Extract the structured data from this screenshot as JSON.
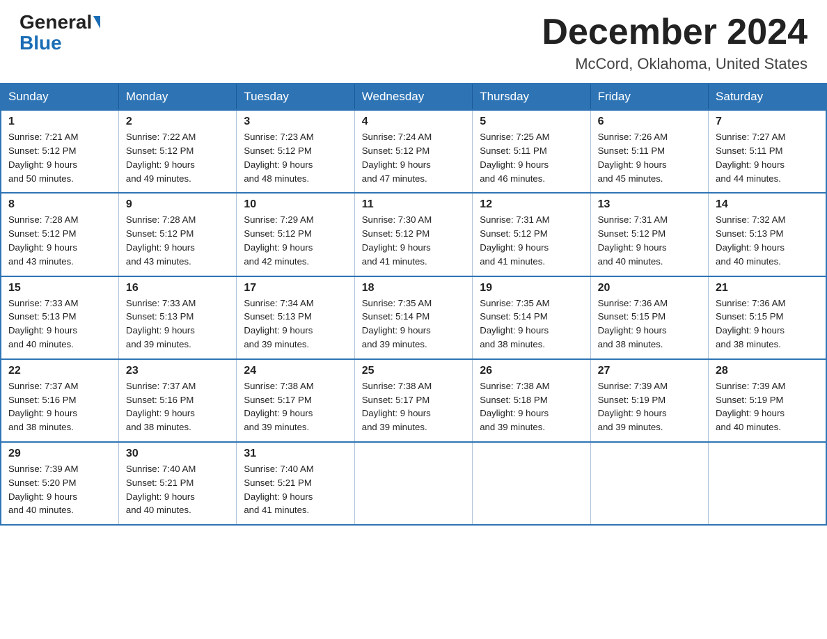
{
  "header": {
    "logo": {
      "part1": "General",
      "part2": "Blue"
    },
    "title": "December 2024",
    "subtitle": "McCord, Oklahoma, United States"
  },
  "calendar": {
    "days_of_week": [
      "Sunday",
      "Monday",
      "Tuesday",
      "Wednesday",
      "Thursday",
      "Friday",
      "Saturday"
    ],
    "weeks": [
      [
        {
          "day": "1",
          "sunrise": "7:21 AM",
          "sunset": "5:12 PM",
          "daylight": "9 hours and 50 minutes."
        },
        {
          "day": "2",
          "sunrise": "7:22 AM",
          "sunset": "5:12 PM",
          "daylight": "9 hours and 49 minutes."
        },
        {
          "day": "3",
          "sunrise": "7:23 AM",
          "sunset": "5:12 PM",
          "daylight": "9 hours and 48 minutes."
        },
        {
          "day": "4",
          "sunrise": "7:24 AM",
          "sunset": "5:12 PM",
          "daylight": "9 hours and 47 minutes."
        },
        {
          "day": "5",
          "sunrise": "7:25 AM",
          "sunset": "5:11 PM",
          "daylight": "9 hours and 46 minutes."
        },
        {
          "day": "6",
          "sunrise": "7:26 AM",
          "sunset": "5:11 PM",
          "daylight": "9 hours and 45 minutes."
        },
        {
          "day": "7",
          "sunrise": "7:27 AM",
          "sunset": "5:11 PM",
          "daylight": "9 hours and 44 minutes."
        }
      ],
      [
        {
          "day": "8",
          "sunrise": "7:28 AM",
          "sunset": "5:12 PM",
          "daylight": "9 hours and 43 minutes."
        },
        {
          "day": "9",
          "sunrise": "7:28 AM",
          "sunset": "5:12 PM",
          "daylight": "9 hours and 43 minutes."
        },
        {
          "day": "10",
          "sunrise": "7:29 AM",
          "sunset": "5:12 PM",
          "daylight": "9 hours and 42 minutes."
        },
        {
          "day": "11",
          "sunrise": "7:30 AM",
          "sunset": "5:12 PM",
          "daylight": "9 hours and 41 minutes."
        },
        {
          "day": "12",
          "sunrise": "7:31 AM",
          "sunset": "5:12 PM",
          "daylight": "9 hours and 41 minutes."
        },
        {
          "day": "13",
          "sunrise": "7:31 AM",
          "sunset": "5:12 PM",
          "daylight": "9 hours and 40 minutes."
        },
        {
          "day": "14",
          "sunrise": "7:32 AM",
          "sunset": "5:13 PM",
          "daylight": "9 hours and 40 minutes."
        }
      ],
      [
        {
          "day": "15",
          "sunrise": "7:33 AM",
          "sunset": "5:13 PM",
          "daylight": "9 hours and 40 minutes."
        },
        {
          "day": "16",
          "sunrise": "7:33 AM",
          "sunset": "5:13 PM",
          "daylight": "9 hours and 39 minutes."
        },
        {
          "day": "17",
          "sunrise": "7:34 AM",
          "sunset": "5:13 PM",
          "daylight": "9 hours and 39 minutes."
        },
        {
          "day": "18",
          "sunrise": "7:35 AM",
          "sunset": "5:14 PM",
          "daylight": "9 hours and 39 minutes."
        },
        {
          "day": "19",
          "sunrise": "7:35 AM",
          "sunset": "5:14 PM",
          "daylight": "9 hours and 38 minutes."
        },
        {
          "day": "20",
          "sunrise": "7:36 AM",
          "sunset": "5:15 PM",
          "daylight": "9 hours and 38 minutes."
        },
        {
          "day": "21",
          "sunrise": "7:36 AM",
          "sunset": "5:15 PM",
          "daylight": "9 hours and 38 minutes."
        }
      ],
      [
        {
          "day": "22",
          "sunrise": "7:37 AM",
          "sunset": "5:16 PM",
          "daylight": "9 hours and 38 minutes."
        },
        {
          "day": "23",
          "sunrise": "7:37 AM",
          "sunset": "5:16 PM",
          "daylight": "9 hours and 38 minutes."
        },
        {
          "day": "24",
          "sunrise": "7:38 AM",
          "sunset": "5:17 PM",
          "daylight": "9 hours and 39 minutes."
        },
        {
          "day": "25",
          "sunrise": "7:38 AM",
          "sunset": "5:17 PM",
          "daylight": "9 hours and 39 minutes."
        },
        {
          "day": "26",
          "sunrise": "7:38 AM",
          "sunset": "5:18 PM",
          "daylight": "9 hours and 39 minutes."
        },
        {
          "day": "27",
          "sunrise": "7:39 AM",
          "sunset": "5:19 PM",
          "daylight": "9 hours and 39 minutes."
        },
        {
          "day": "28",
          "sunrise": "7:39 AM",
          "sunset": "5:19 PM",
          "daylight": "9 hours and 40 minutes."
        }
      ],
      [
        {
          "day": "29",
          "sunrise": "7:39 AM",
          "sunset": "5:20 PM",
          "daylight": "9 hours and 40 minutes."
        },
        {
          "day": "30",
          "sunrise": "7:40 AM",
          "sunset": "5:21 PM",
          "daylight": "9 hours and 40 minutes."
        },
        {
          "day": "31",
          "sunrise": "7:40 AM",
          "sunset": "5:21 PM",
          "daylight": "9 hours and 41 minutes."
        },
        null,
        null,
        null,
        null
      ]
    ]
  }
}
